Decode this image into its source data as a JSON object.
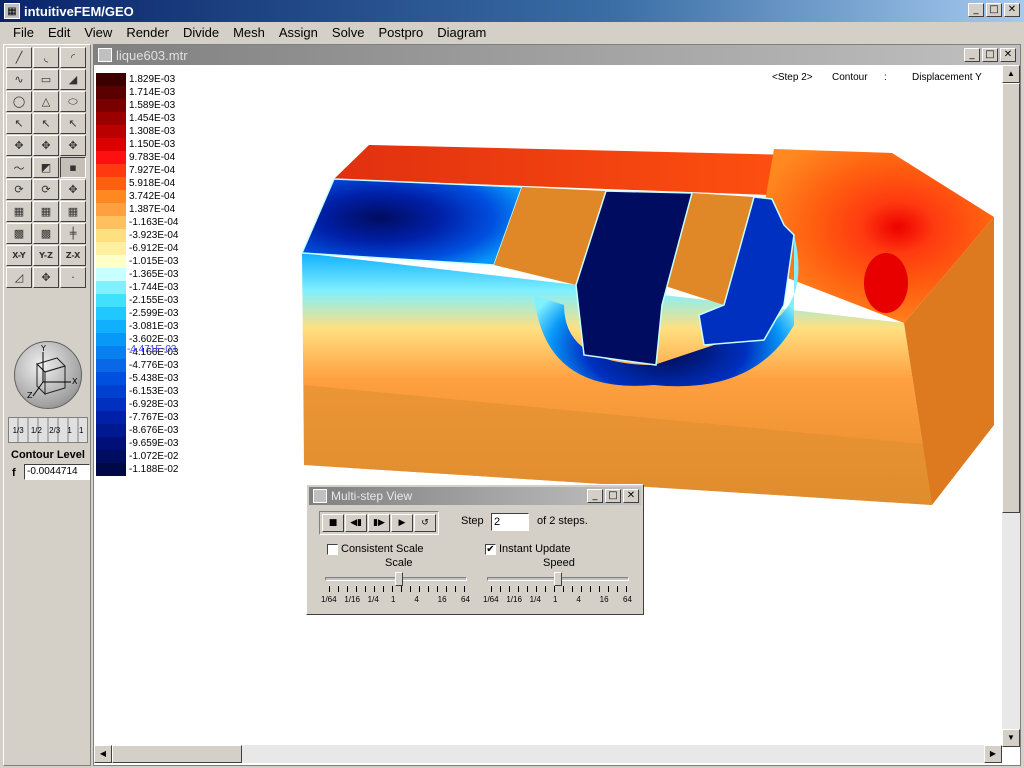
{
  "app": {
    "title": "intuitiveFEM/GEO"
  },
  "menu": [
    "File",
    "Edit",
    "View",
    "Render",
    "Divide",
    "Mesh",
    "Assign",
    "Solve",
    "Postpro",
    "Diagram"
  ],
  "toolbox": {
    "tools": [
      "line-icon",
      "arc-icon",
      "arc2-icon",
      "spline-icon",
      "rect-icon",
      "surface-icon",
      "circle-icon",
      "cone-icon",
      "cylinder-icon",
      "select-icon",
      "select-edge-icon",
      "select-face-icon",
      "pick-point-icon",
      "pick-node-icon",
      "pick-solid-icon",
      "curve-icon",
      "patch-icon",
      "contour-select-icon",
      "rotate-x-icon",
      "rotate-icon",
      "move-icon",
      "box-icon",
      "box2-icon",
      "box3-icon",
      "mesh-icon",
      "mesh2-icon",
      "cut-icon",
      "x-y-view-icon",
      "y-z-view-icon",
      "z-x-view-icon",
      "iso-view-icon",
      "pan-icon",
      "point-icon"
    ],
    "tool_glyphs": [
      "╱",
      "◟",
      "◜",
      "∿",
      "▭",
      "◢",
      "◯",
      "△",
      "⬭",
      "↖",
      "↖",
      "↖",
      "✥",
      "✥",
      "✥",
      "〜",
      "◩",
      "▪",
      "⟳",
      "⟳",
      "✥",
      "▦",
      "▦",
      "▦",
      "▩",
      "▩",
      "╪",
      "X-Y",
      "Y-Z",
      "Z-X",
      "◿",
      "✥",
      "·"
    ],
    "pressed_index": 17,
    "ruler_labels": [
      "1/3",
      "1/2",
      "2/3",
      "1",
      "1"
    ],
    "contour_level_label": "Contour Level",
    "contour_f_label": "f",
    "contour_f_value": "-0.0044714"
  },
  "child_window": {
    "title": "lique603.mtr",
    "step_text": "<Step 2>",
    "mode": "Contour",
    "sep": ":",
    "quantity": "Displacement Y"
  },
  "legend": {
    "values": [
      "1.829E-03",
      "1.714E-03",
      "1.589E-03",
      "1.454E-03",
      "1.308E-03",
      "1.150E-03",
      "9.783E-04",
      "7.927E-04",
      "5.918E-04",
      "3.742E-04",
      "1.387E-04",
      "-1.163E-04",
      "-3.923E-04",
      "-6.912E-04",
      "-1.015E-03",
      "-1.365E-03",
      "-1.744E-03",
      "-2.155E-03",
      "-2.599E-03",
      "-3.081E-03",
      "-3.602E-03",
      "-4.166E-03",
      "-4.776E-03",
      "-5.438E-03",
      "-6.153E-03",
      "-6.928E-03",
      "-7.767E-03",
      "-8.676E-03",
      "-9.659E-03",
      "-1.072E-02",
      "-1.188E-02"
    ],
    "colors": [
      "#3a0000",
      "#5a0000",
      "#7a0000",
      "#9a0000",
      "#bb0000",
      "#dd0000",
      "#ff1010",
      "#ff3a10",
      "#ff6010",
      "#ff8820",
      "#ffa040",
      "#ffc060",
      "#ffe080",
      "#fff0a0",
      "#ffffc8",
      "#c8ffff",
      "#80f0ff",
      "#40e0ff",
      "#20c8ff",
      "#10b0ff",
      "#0898f8",
      "#0880f0",
      "#0868e8",
      "#0050e0",
      "#0040d0",
      "#0030c0",
      "#0020a8",
      "#001890",
      "#001078",
      "#000c60",
      "#000848"
    ],
    "marker": "-4.471E-03"
  },
  "dialog": {
    "title": "Multi-step View",
    "play_buttons": [
      "stop-icon",
      "step-back-icon",
      "play-icon",
      "step-forward-icon",
      "loop-icon"
    ],
    "play_glyphs": [
      "■",
      "◀▮",
      "▮▶",
      "▶",
      "↺"
    ],
    "step_label": "Step",
    "step_value": "2",
    "of_steps": "of 2 steps.",
    "consistent_scale": {
      "label": "Consistent Scale",
      "checked": false
    },
    "instant_update": {
      "label": "Instant Update",
      "checked": true
    },
    "scale_label": "Scale",
    "speed_label": "Speed",
    "tick_labels": [
      "1/64",
      "1/16",
      "1/4",
      "1",
      "4",
      "16",
      "64"
    ]
  }
}
